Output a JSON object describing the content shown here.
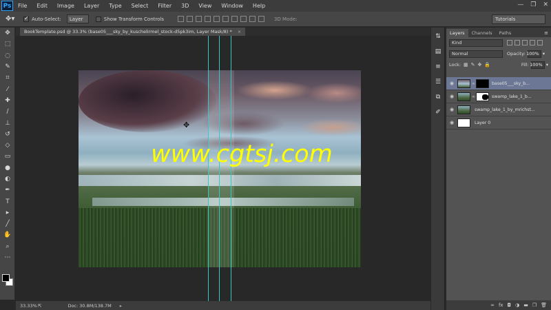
{
  "menubar": {
    "logo": "Ps",
    "items": [
      "File",
      "Edit",
      "Image",
      "Layer",
      "Type",
      "Select",
      "Filter",
      "3D",
      "View",
      "Window",
      "Help"
    ],
    "window_controls": [
      "—",
      "❐",
      "✕"
    ]
  },
  "options": {
    "auto_select_label": "Auto-Select:",
    "auto_select_checked": true,
    "auto_select_value": "Layer",
    "transform_label": "Show Transform Controls",
    "mode3d_label": "3D Mode:",
    "workspace": "Tutorials"
  },
  "document": {
    "tab_title": "BookTemplate.psd @ 33.3% (base05___sky_by_kuschelirmel_stock-d5pk3im, Layer Mask/8) *",
    "close": "×"
  },
  "watermark": "www.cgtsj.com",
  "status": {
    "zoom": "33.33%",
    "doc": "Doc: 30.8M/138.7M"
  },
  "layers_panel": {
    "tabs": [
      "Layers",
      "Channels",
      "Paths"
    ],
    "active_tab": "Layers",
    "filter_kind": "Kind",
    "blend_mode": "Normal",
    "opacity_label": "Opacity:",
    "opacity": "100%",
    "lock_label": "Lock:",
    "fill_label": "Fill:",
    "fill": "100%",
    "layers": [
      {
        "name": "base05___sky_b...",
        "selected": true
      },
      {
        "name": "swamp_lake_1_b...",
        "selected": false
      },
      {
        "name": "swamp_lake_1_by_mrichst...",
        "selected": false
      },
      {
        "name": "Layer 0",
        "selected": false
      }
    ],
    "footer_icons": [
      "link-icon",
      "fx-icon",
      "mask-icon",
      "adjustment-icon",
      "folder-icon",
      "new-layer-icon",
      "trash-icon"
    ]
  },
  "colors": {
    "guide": "#36c9c1",
    "watermark": "#ffff00",
    "selected_layer": "#6b7795"
  }
}
